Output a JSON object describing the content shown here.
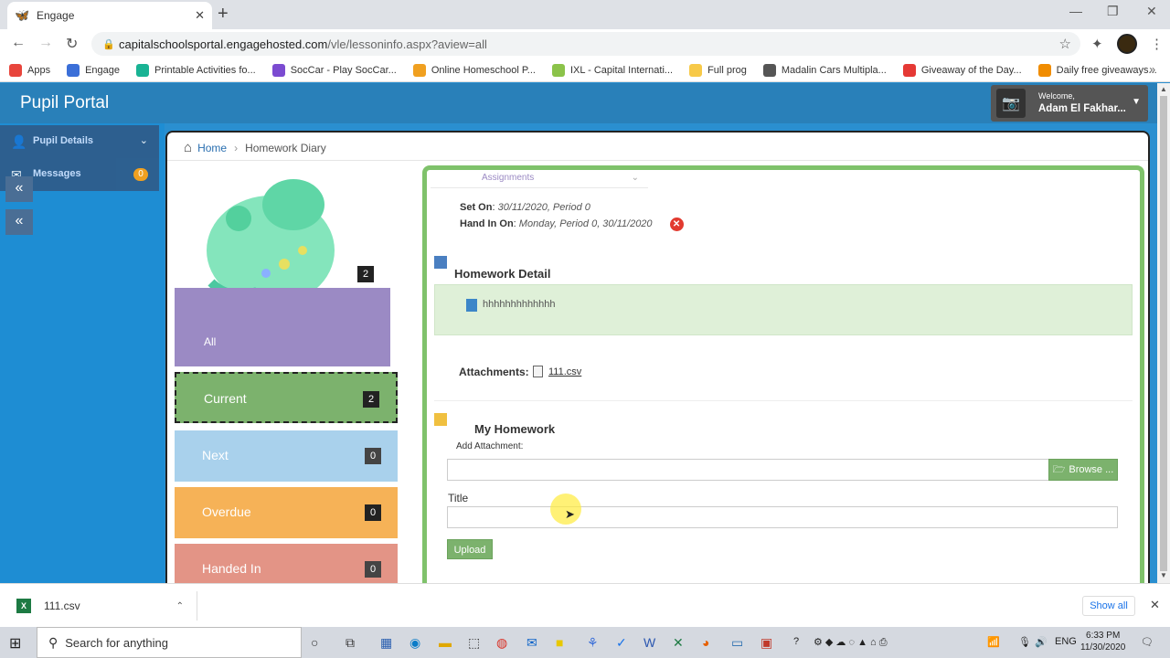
{
  "browser": {
    "tab_title": "Engage",
    "url_host": "capitalschoolsportal.engagehosted.com",
    "url_path": "/vle/lessoninfo.aspx?aview=all",
    "bookmarks": [
      {
        "label": "Apps",
        "color": "#e8453c"
      },
      {
        "label": "Engage",
        "color": "#3b6fd8"
      },
      {
        "label": "Printable Activities fo...",
        "color": "#19b394"
      },
      {
        "label": "SocCar - Play SocCar...",
        "color": "#7b4bd1"
      },
      {
        "label": "Online Homeschool P...",
        "color": "#f0a020"
      },
      {
        "label": "IXL - Capital Internati...",
        "color": "#8bc34a"
      },
      {
        "label": "Full prog",
        "color": "#f7c948"
      },
      {
        "label": "Madalin Cars Multipla...",
        "color": "#555555"
      },
      {
        "label": "Giveaway of the Day...",
        "color": "#e53935"
      },
      {
        "label": "Daily free giveaways...",
        "color": "#f08c00"
      }
    ]
  },
  "portal": {
    "title": "Pupil Portal",
    "welcome_label": "Welcome,",
    "user_name": "Adam El Fakhar..."
  },
  "sidebar": {
    "items": [
      {
        "label": "Pupil Details",
        "icon": "user-icon"
      },
      {
        "label": "Messages",
        "icon": "envelope-icon"
      }
    ],
    "messages_badge": "0"
  },
  "breadcrumb": {
    "home": "Home",
    "current": "Homework Diary"
  },
  "filters": {
    "all": {
      "label": "All",
      "count": "2"
    },
    "current": {
      "label": "Current",
      "count": "2"
    },
    "next": {
      "label": "Next",
      "count": "0"
    },
    "overdue": {
      "label": "Overdue",
      "count": "0"
    },
    "handed_in": {
      "label": "Handed In",
      "count": "0"
    }
  },
  "assignment": {
    "tab_label": "Assignments",
    "set_on_label": "Set On",
    "set_on_value": "30/11/2020, Period 0",
    "hand_in_label": "Hand In On",
    "hand_in_value": "Monday, Period 0, 30/11/2020",
    "detail_title": "Homework Detail",
    "detail_text": "hhhhhhhhhhhhh",
    "attachments_label": "Attachments:",
    "attachment_file": "111.csv",
    "my_homework_title": "My Homework",
    "add_attachment_label": "Add Attachment:",
    "browse_label": "Browse ...",
    "title_label": "Title",
    "upload_label": "Upload"
  },
  "downloads": {
    "file": "111.csv",
    "show_all": "Show all"
  },
  "taskbar": {
    "search_placeholder": "Search for anything",
    "lang": "ENG",
    "time": "6:33 PM",
    "date": "11/30/2020"
  }
}
